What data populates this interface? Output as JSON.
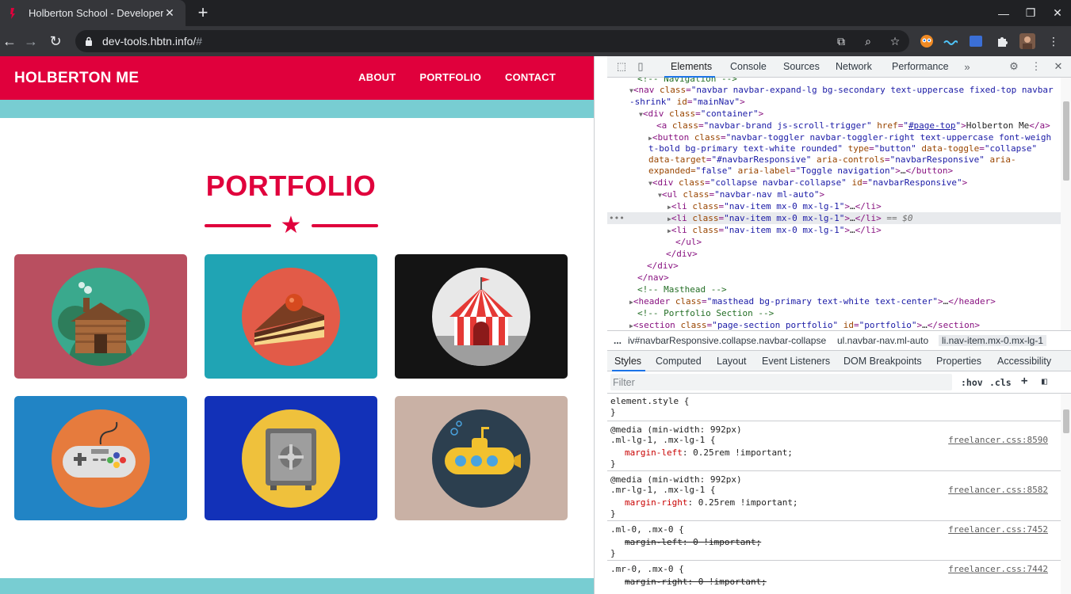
{
  "browser": {
    "tab_title": "Holberton School - Developer",
    "url_host": "dev-tools.hbtn.info/",
    "url_hash": "#"
  },
  "site": {
    "brand": "HOLBERTON ME",
    "menu": [
      "ABOUT",
      "PORTFOLIO",
      "CONTACT"
    ],
    "section_title": "PORTFOLIO",
    "cards": [
      {
        "name": "cabin",
        "bg": "#b94f60",
        "circle": "#3aa98d"
      },
      {
        "name": "cake",
        "bg": "#20a4b4",
        "circle": "#e25b48"
      },
      {
        "name": "circus",
        "bg": "#141414",
        "circle": "#e8e8e8"
      },
      {
        "name": "game",
        "bg": "#2184c5",
        "circle": "#e67b3d"
      },
      {
        "name": "safe",
        "bg": "#1231b8",
        "circle": "#efc13c"
      },
      {
        "name": "submarine",
        "bg": "#c9b1a5",
        "circle": "#2c3f4f"
      }
    ],
    "colors": {
      "primary": "#e0003c",
      "teal": "#78cdd2"
    }
  },
  "devtools": {
    "tabs": [
      "Elements",
      "Console",
      "Sources",
      "Network",
      "Performance"
    ],
    "active_tab": "Elements",
    "elements": {
      "l0": "<!-- Navigation -->",
      "l1_tag": "nav",
      "l1_class": "navbar navbar-expand-lg bg-secondary text-uppercase fixed-top navbar",
      "l2": "-shrink\"",
      "l2_id": "mainNav",
      "l3_class": "container",
      "l4_class": "navbar-brand js-scroll-trigger",
      "l4_href": "#page-top",
      "l4_text": "Holberton Me",
      "l5_class": "navbar-toggler navbar-toggler-right text-uppercase font-weigh",
      "l6": "t-bold bg-primary text-white rounded\"",
      "l6_type": "button",
      "l6_toggle": "collapse",
      "l7_target": "#navbarResponsive",
      "l7_controls": "navbarResponsive",
      "l8": "expanded=",
      "l8_exp": "\"false\"",
      "l8_label": "Toggle navigation",
      "l9_class": "collapse navbar-collapse",
      "l9_id": "navbarResponsive",
      "l10_class": "navbar-nav ml-auto",
      "li_class": "nav-item mx-0 mx-lg-1",
      "selected_marker": "== $0",
      "c_masthead": "<!-- Masthead -->",
      "header_class": "masthead bg-primary text-white text-center",
      "c_portfolio": "<!-- Portfolio Section -->",
      "section_class": "page-section portfolio",
      "section_id": "portfolio"
    },
    "breadcrumb": [
      "...",
      "iv#navbarResponsive.collapse.navbar-collapse",
      "ul.navbar-nav.ml-auto",
      "li.nav-item.mx-0.mx-lg-1"
    ],
    "subtabs": [
      "Styles",
      "Computed",
      "Layout",
      "Event Listeners",
      "DOM Breakpoints",
      "Properties",
      "Accessibility"
    ],
    "filter_placeholder": "Filter",
    "hov": ":hov",
    "cls": ".cls",
    "styles": {
      "element_style": "element.style {",
      "close": "}",
      "media1": "@media (min-width: 992px)",
      "sel1": ".ml-lg-1, .mx-lg-1 {",
      "src1": "freelancer.css:8590",
      "prop1_name": "margin-left",
      "prop1_val": ": 0.25rem !important;",
      "media2": "@media (min-width: 992px)",
      "sel2": ".mr-lg-1, .mx-lg-1 {",
      "src2": "freelancer.css:8582",
      "prop2_name": "margin-right",
      "prop2_val": ": 0.25rem !important;",
      "sel3": ".ml-0, .mx-0 {",
      "src3": "freelancer.css:7452",
      "prop3": "margin-left: 0 !important;",
      "sel4": ".mr-0, .mx-0 {",
      "src4": "freelancer.css:7442",
      "prop4": "margin-right: 0 !important;"
    }
  }
}
